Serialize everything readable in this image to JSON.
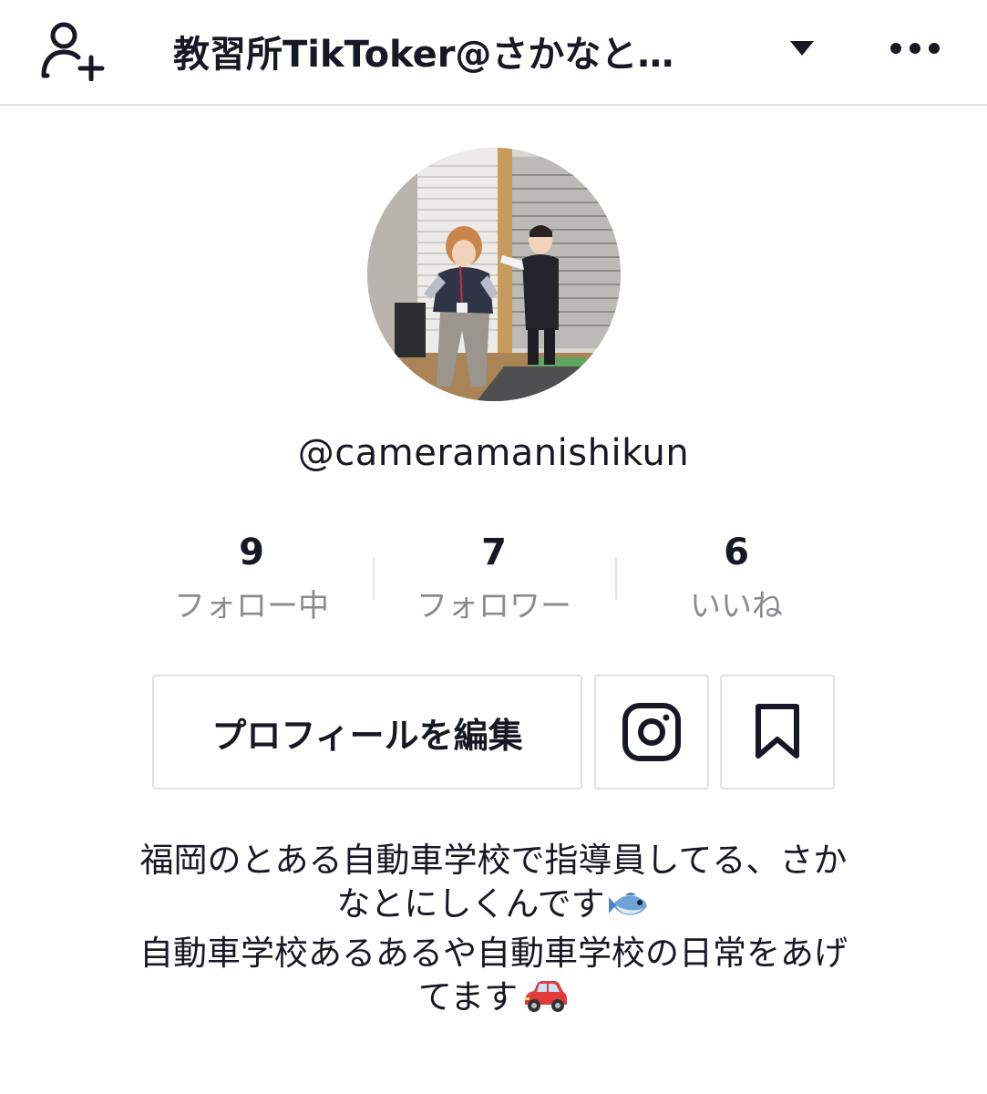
{
  "header": {
    "add_friend_icon": "add-person-icon",
    "account_title": "教習所TikToker@さかなと…",
    "dropdown_icon": "triangle-down-icon",
    "more_icon": "more-dots-icon"
  },
  "profile": {
    "username": "@cameramanishikun"
  },
  "stats": [
    {
      "value": "9",
      "label": "フォロー中"
    },
    {
      "value": "7",
      "label": "フォロワー"
    },
    {
      "value": "6",
      "label": "いいね"
    }
  ],
  "actions": {
    "edit_label": "プロフィールを編集",
    "instagram_icon": "instagram-icon",
    "bookmark_icon": "bookmark-icon"
  },
  "bio": {
    "line1": "福岡のとある自動車学校で指導員してる、さか",
    "line2": "なとにしくんです",
    "line2_emoji": "fish-emoji",
    "line3": "自動車学校あるあるや自動車学校の日常をあげ",
    "line4": "てます",
    "line4_emoji": "car-emoji"
  },
  "colors": {
    "text_primary": "#161823",
    "text_secondary": "#8a8b91",
    "border": "#e1e1e2"
  }
}
